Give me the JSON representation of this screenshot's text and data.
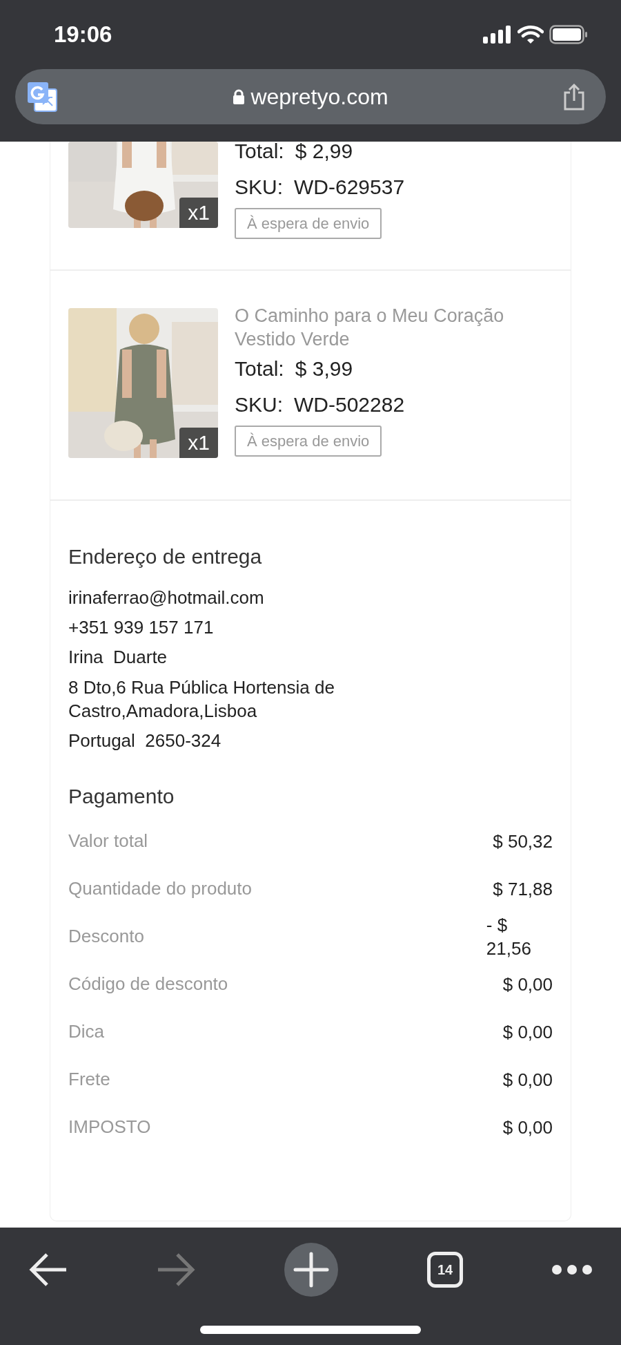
{
  "status_bar": {
    "time": "19:06"
  },
  "browser": {
    "url": "wepretyo.com"
  },
  "products": [
    {
      "total_label": "Total:",
      "total": "$ 2,99",
      "sku_label": "SKU:",
      "sku": "WD-629537",
      "status": "À espera de envio",
      "quantity": "x1"
    },
    {
      "title": "O Caminho para o Meu Coração Vestido Verde",
      "total_label": "Total:",
      "total": "$ 3,99",
      "sku_label": "SKU:",
      "sku": "WD-502282",
      "status": "À espera de envio",
      "quantity": "x1"
    }
  ],
  "address": {
    "heading": "Endereço de entrega",
    "lines": [
      "irinaferrao@hotmail.com",
      "+351 939 157 171",
      "Irina  Duarte",
      "8 Dto,6 Rua Pública Hortensia de Castro,Amadora,Lisboa",
      "Portugal  2650-324"
    ]
  },
  "payment": {
    "heading": "Pagamento",
    "rows": [
      {
        "label": "Valor total",
        "value": "$ 50,32"
      },
      {
        "label": "Quantidade do produto",
        "value": "$ 71,88"
      },
      {
        "label": "Desconto",
        "value": "- $ 21,56"
      },
      {
        "label": "Código de desconto",
        "value": "$ 0,00"
      },
      {
        "label": "Dica",
        "value": "$ 0,00"
      },
      {
        "label": "Frete",
        "value": "$ 0,00"
      },
      {
        "label": "IMPOSTO",
        "value": "$ 0,00"
      }
    ]
  },
  "toolbar": {
    "nav_buttons": [
      {
        "kind": "back",
        "disabled": false
      },
      {
        "kind": "forward",
        "disabled": true
      }
    ],
    "tab_count": "14"
  }
}
